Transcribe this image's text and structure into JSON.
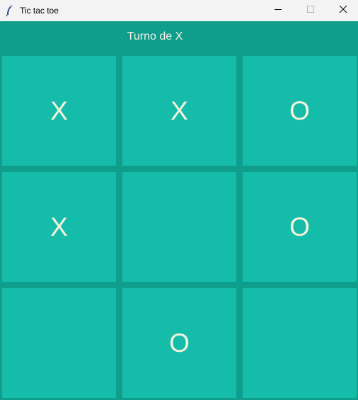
{
  "window": {
    "title": "Tic tac toe",
    "icon": "feather-icon",
    "controls": [
      "minimize-icon",
      "maximize-icon",
      "close-icon"
    ]
  },
  "game": {
    "status": "Turno de X",
    "board": [
      [
        "X",
        "X",
        "O"
      ],
      [
        "X",
        "",
        "O"
      ],
      [
        "",
        "O",
        ""
      ]
    ]
  },
  "colors": {
    "background": "#0f9e8c",
    "cell": "#15bca9",
    "mark": "#f5f2dc",
    "titlebar": "#f3f3f3"
  }
}
